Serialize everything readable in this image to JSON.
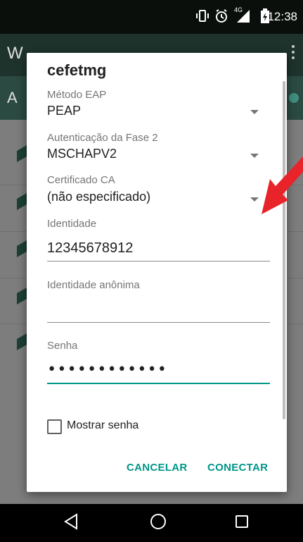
{
  "status_bar": {
    "time": "12:38",
    "network_label": "4G",
    "icons": [
      "vibrate-icon",
      "alarm-icon",
      "signal-icon",
      "battery-charging-icon"
    ]
  },
  "background_app": {
    "title_partial": "W",
    "subtitle_partial": "A"
  },
  "dialog": {
    "title": "cefetmg",
    "eap_method": {
      "label": "Método EAP",
      "value": "PEAP"
    },
    "phase2_auth": {
      "label": "Autenticação da Fase 2",
      "value": "MSCHAPV2"
    },
    "ca_certificate": {
      "label": "Certificado CA",
      "value": "(não especificado)"
    },
    "identity": {
      "label": "Identidade",
      "value": "12345678912"
    },
    "anonymous_identity": {
      "label": "Identidade anônima",
      "value": ""
    },
    "password": {
      "label": "Senha",
      "masked_value": "••••••••••••"
    },
    "show_password": {
      "label": "Mostrar senha",
      "checked": false
    },
    "cancel_label": "CANCELAR",
    "connect_label": "CONECTAR"
  },
  "navigation_bar": {
    "icons": [
      "back-icon",
      "home-icon",
      "recents-icon"
    ]
  },
  "colors": {
    "accent": "#009688",
    "annotation_arrow": "#e8232a",
    "status_bar_bg": "#0a0f0c"
  }
}
